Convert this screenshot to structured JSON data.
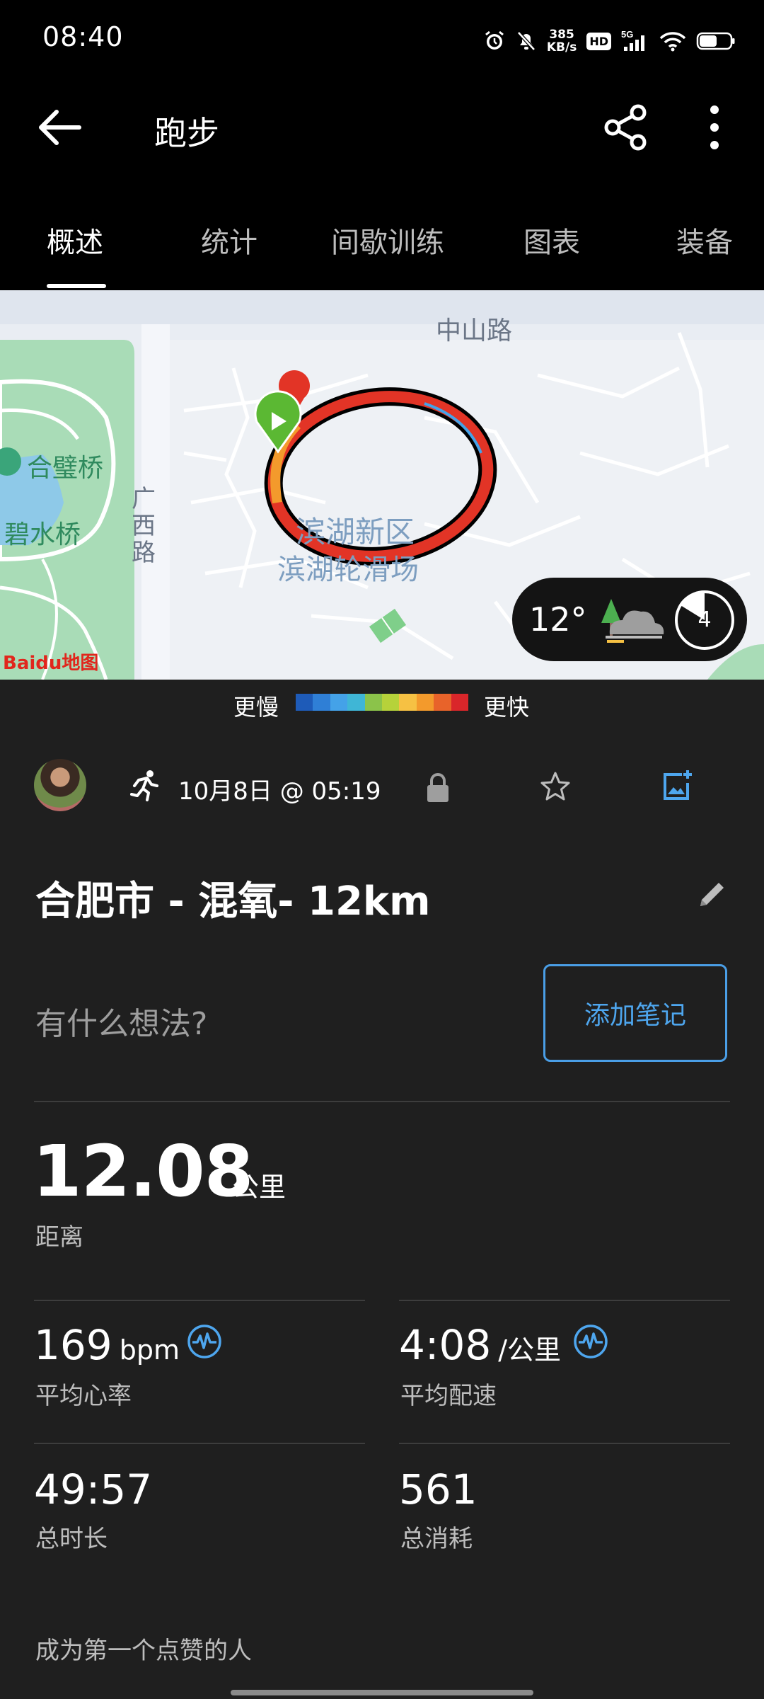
{
  "status_bar": {
    "time": "08:40",
    "net_speed_value": "385",
    "net_speed_unit": "KB/s",
    "hd_label": "HD",
    "network_label": "5G",
    "icons": [
      "alarm-icon",
      "mute-icon",
      "hd-icon",
      "signal-icon",
      "wifi-icon",
      "battery-icon"
    ]
  },
  "app_bar": {
    "title": "跑步",
    "icons": [
      "back-arrow-icon",
      "share-icon",
      "more-vert-icon"
    ]
  },
  "tabs": [
    {
      "label": "概述",
      "active": true
    },
    {
      "label": "统计",
      "active": false
    },
    {
      "label": "间歇训练",
      "active": false
    },
    {
      "label": "图表",
      "active": false
    },
    {
      "label": "装备",
      "active": false
    }
  ],
  "map": {
    "labels": {
      "road_top": "中山路",
      "bridge_1": "合璧桥",
      "bridge_2": "碧水桥",
      "road_left": "广西路",
      "district": "滨湖新区",
      "area": "滨湖轮滑场"
    },
    "logo": "Baidu地图",
    "weather": {
      "temperature": "12°",
      "icon": "cloud-tree-icon",
      "count": "4"
    }
  },
  "legend": {
    "slower": "更慢",
    "faster": "更快",
    "colors": [
      "#1e5bb8",
      "#2f7fd6",
      "#44a2e8",
      "#3fb6d6",
      "#8bc34a",
      "#b6d23a",
      "#f6c143",
      "#f39a2c",
      "#e8632a",
      "#d9262a"
    ]
  },
  "activity": {
    "avatar": "avatar",
    "type_icon": "running-icon",
    "date": "10月8日 @ 05:19",
    "privacy_icon": "lock-icon",
    "favorite_icon": "star-icon",
    "photo_icon": "add-photo-icon",
    "title": "合肥市 - 混氧- 12km",
    "edit_icon": "pencil-icon"
  },
  "note": {
    "prompt": "有什么想法?",
    "button_label": "添加笔记"
  },
  "stats": {
    "distance": {
      "value": "12.08",
      "unit": "公里",
      "label": "距离"
    },
    "heart_rate": {
      "value": "169",
      "unit": "bpm",
      "label": "平均心率",
      "icon": "pulse-icon"
    },
    "pace": {
      "value": "4:08",
      "unit": "/公里",
      "label": "平均配速",
      "icon": "pulse-icon"
    },
    "duration": {
      "value": "49:57",
      "label": "总时长"
    },
    "calories": {
      "value": "561",
      "label": "总消耗"
    }
  },
  "likes": "成为第一个点赞的人",
  "colors": {
    "background": "#1f1f1f",
    "header": "#000000",
    "accent": "#4ea6ee",
    "route_start": "#5bb833"
  }
}
